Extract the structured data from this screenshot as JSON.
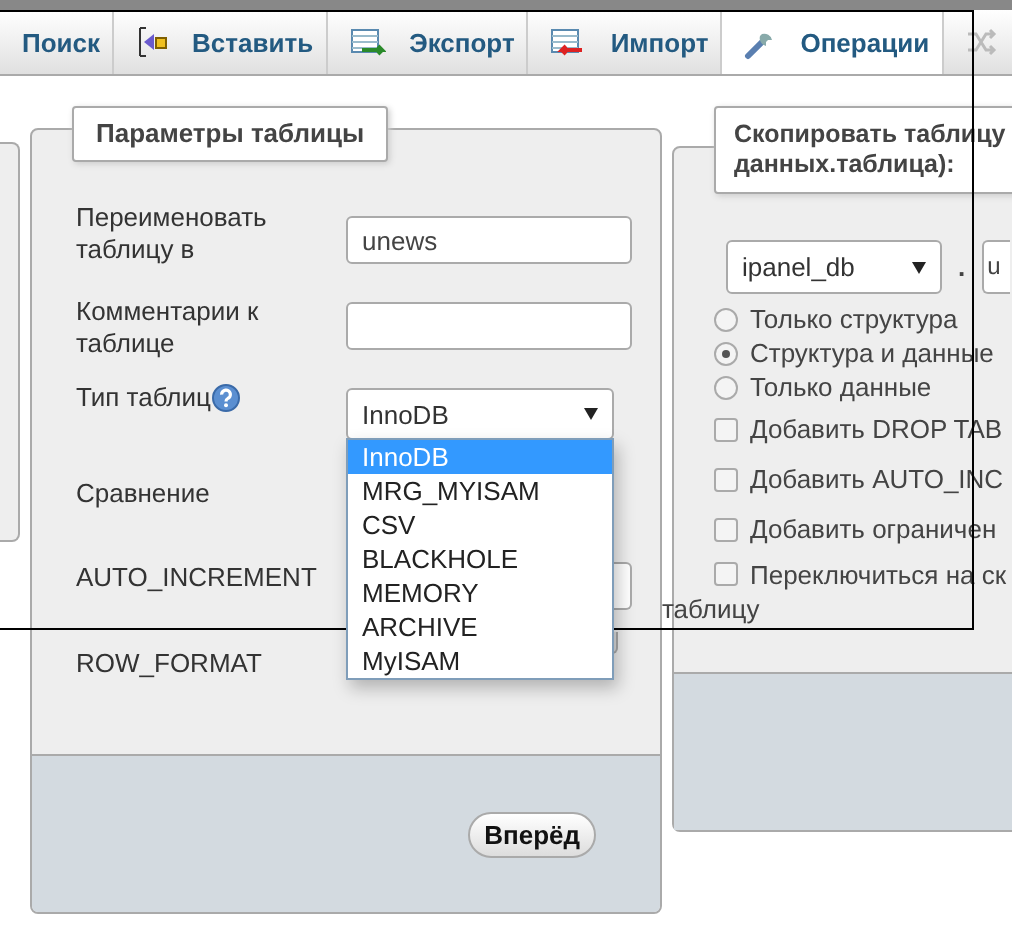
{
  "tabs": [
    {
      "label": "Поиск",
      "selected": false
    },
    {
      "label": "Вставить",
      "selected": false
    },
    {
      "label": "Экспорт",
      "selected": false
    },
    {
      "label": "Импорт",
      "selected": false
    },
    {
      "label": "Операции",
      "selected": true
    },
    {
      "selected": false
    }
  ],
  "table_options": {
    "legend": "Параметры таблицы",
    "rename": {
      "label": "Переименовать таблицу в",
      "value": "unews"
    },
    "comment": {
      "label": "Комментарии к таблице"
    },
    "engine": {
      "label": "Тип таблиц",
      "value": "InnoDB",
      "expanded": true,
      "options": [
        {
          "label": "InnoDB",
          "selected": true
        },
        {
          "label": "MRG_MYISAM",
          "selected": false
        },
        {
          "label": "CSV",
          "selected": false
        },
        {
          "label": "BLACKHOLE",
          "selected": false
        },
        {
          "label": "MEMORY",
          "selected": false
        },
        {
          "label": "ARCHIVE",
          "selected": false
        },
        {
          "label": "MyISAM",
          "selected": false
        }
      ]
    },
    "collation": {
      "label": "Сравнение"
    },
    "auto_increment": {
      "label": "AUTO_INCREMENT"
    },
    "row_format": {
      "label": "ROW_FORMAT"
    },
    "submit": "Вперёд"
  },
  "copy_table": {
    "legend_lines": [
      "Скопировать таблицу",
      "данных.таблица):"
    ],
    "database": "ipanel_db",
    "separator": ".",
    "table_value": "u",
    "modes": [
      {
        "label": "Только структура",
        "selected": false
      },
      {
        "label": "Структура и данные",
        "selected": true
      },
      {
        "label": "Только данные",
        "selected": false
      }
    ],
    "options": [
      {
        "label": "Добавить DROP TAB",
        "checked": false
      },
      {
        "label": "Добавить AUTO_INC",
        "checked": false
      },
      {
        "label": "Добавить ограничен",
        "checked": false
      },
      {
        "label": "Переключиться на ск",
        "checked": false,
        "continued": "таблицу"
      }
    ]
  }
}
